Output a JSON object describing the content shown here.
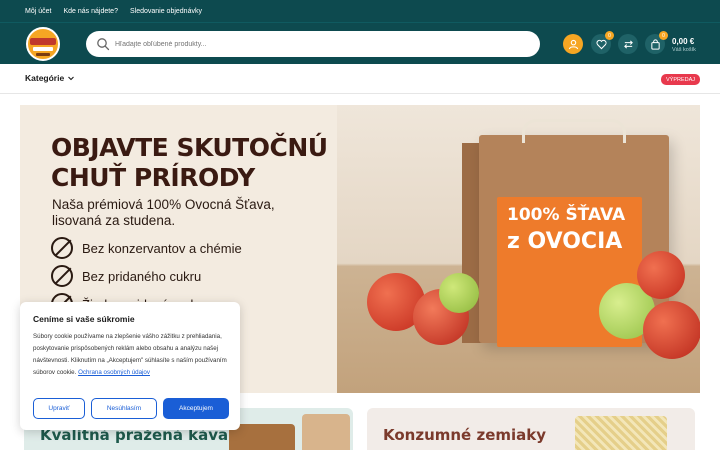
{
  "topbar": {
    "links": [
      "Môj účet",
      "Kde nás nájdete?",
      "Sledovanie objednávky"
    ]
  },
  "header": {
    "logo_text": "BB FARMA",
    "search_placeholder": "Hľadajte obľúbené produkty...",
    "wishlist_count": "0",
    "cart_count": "0",
    "cart_amount": "0,00 €",
    "cart_label": "Váš košík"
  },
  "nav": {
    "categories_label": "Kategórie",
    "sale_label": "VÝPREDAJ"
  },
  "hero": {
    "title_line1": "OBJAVTE SKUTOČNÚ",
    "title_line2": "CHUŤ PRÍRODY",
    "subtitle_line1": "Naša prémiová 100% Ovocná Šťava,",
    "subtitle_line2": "lisovaná za studena.",
    "features": [
      "Bez konzervantov a chémie",
      "Bez pridaného cukru",
      "Žiadna pridaná voda"
    ],
    "box_line1": "100% ŠŤAVA",
    "box_line2": "z OVOCIA"
  },
  "cookie": {
    "title": "Ceníme si vaše súkromie",
    "text": "Súbory cookie používame na zlepšenie vášho zážitku z prehliadania, poskytovanie prispôsobených reklám alebo obsahu a analýzu našej návštevnosti. Kliknutím na „Akceptujem\" súhlasíte s naším používaním súborov cookie.",
    "link": "Ochrana osobných údajov",
    "btn_customize": "Upraviť",
    "btn_reject": "Nesúhlasím",
    "btn_accept": "Akceptujem"
  },
  "banners": [
    {
      "title": "Kvalitná pražená káva"
    },
    {
      "title": "Konzumné zemiaky"
    }
  ],
  "colors": {
    "brand_dark": "#0d4a4f",
    "accent_orange": "#f6a623",
    "sale_red": "#e8394d",
    "link_blue": "#1a5ed6"
  }
}
